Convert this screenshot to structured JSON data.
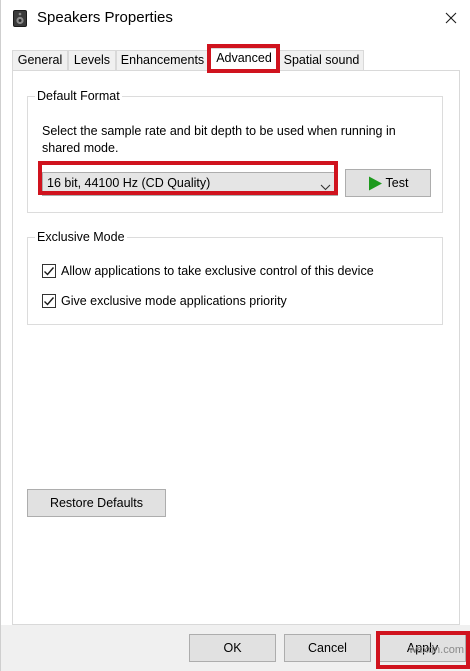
{
  "window": {
    "title": "Speakers Properties",
    "title_icon": "speaker-icon",
    "close_icon": "close-icon"
  },
  "tabs": [
    {
      "label": "General",
      "active": false
    },
    {
      "label": "Levels",
      "active": false
    },
    {
      "label": "Enhancements",
      "active": false
    },
    {
      "label": "Advanced",
      "active": true
    },
    {
      "label": "Spatial sound",
      "active": false
    }
  ],
  "default_format": {
    "legend": "Default Format",
    "description": "Select the sample rate and bit depth to be used when running in shared mode.",
    "selected_format": "16 bit, 44100 Hz (CD Quality)",
    "test_button": "Test",
    "test_icon": "play-icon"
  },
  "exclusive_mode": {
    "legend": "Exclusive Mode",
    "options": [
      {
        "label": "Allow applications to take exclusive control of this device",
        "checked": true
      },
      {
        "label": "Give exclusive mode applications priority",
        "checked": true
      }
    ]
  },
  "restore_defaults": "Restore Defaults",
  "footer": {
    "ok": "OK",
    "cancel": "Cancel",
    "apply": "Apply"
  },
  "highlight_color": "#d0131e",
  "watermark": "wsxdn.com"
}
